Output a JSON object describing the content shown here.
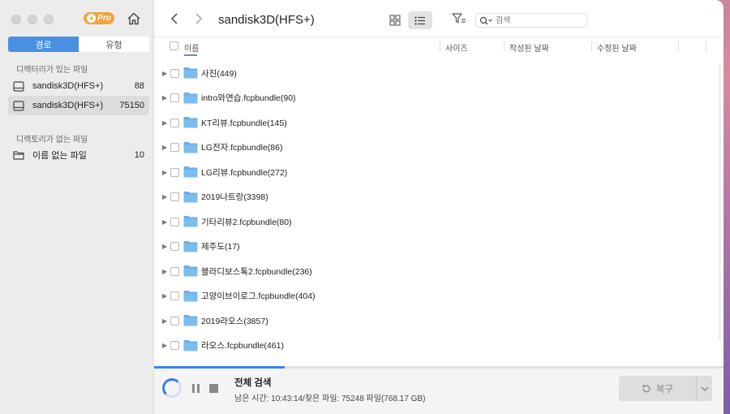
{
  "app": {
    "pro_label": "Pro"
  },
  "sidebar": {
    "tabs": [
      {
        "label": "경로",
        "active": true
      },
      {
        "label": "유형",
        "active": false
      }
    ],
    "section_with_dir": "디렉터리가 있는 파일",
    "section_without_dir": "디렉토리가 없는 파일",
    "drives": [
      {
        "name": "sandisk3D(HFS+)",
        "count": "88",
        "selected": false
      },
      {
        "name": "sandisk3D(HFS+)",
        "count": "75150",
        "selected": true
      }
    ],
    "nodir_items": [
      {
        "name": "이름 없는 파일",
        "count": "10"
      }
    ]
  },
  "toolbar": {
    "back_icon": "chevron-left-icon",
    "forward_icon": "chevron-right-icon",
    "title": "sandisk3D(HFS+)",
    "search_placeholder": "검색"
  },
  "columns": {
    "name": "이름",
    "size": "사이즈",
    "created": "작성된 날짜",
    "modified": "수정된 날짜"
  },
  "files": [
    {
      "name": "사진(449)"
    },
    {
      "name": "intro와연습.fcpbundle(90)"
    },
    {
      "name": "KT리뷰.fcpbundle(145)"
    },
    {
      "name": "LG전자.fcpbundle(86)"
    },
    {
      "name": "LG리뷰.fcpbundle(272)"
    },
    {
      "name": "2019나트랑(3398)"
    },
    {
      "name": "기타리뷰2.fcpbundle(80)"
    },
    {
      "name": "제주도(17)"
    },
    {
      "name": "블라디보스톡2.fcpbundle(236)"
    },
    {
      "name": "고양이브이로그.fcpbundle(404)"
    },
    {
      "name": "2019라오스(3857)"
    },
    {
      "name": "라오스.fcpbundle(461)"
    }
  ],
  "scan": {
    "title": "전체 검색",
    "status": "남은 시간: 10:43:14/찾은 파일: 75248 파일(768.17 GB)",
    "progress": 0.23
  },
  "recover": {
    "label": "복구"
  },
  "colors": {
    "accent": "#4a90e2",
    "folder": "#6aaee8",
    "pro_badge": "#f2a33a"
  }
}
